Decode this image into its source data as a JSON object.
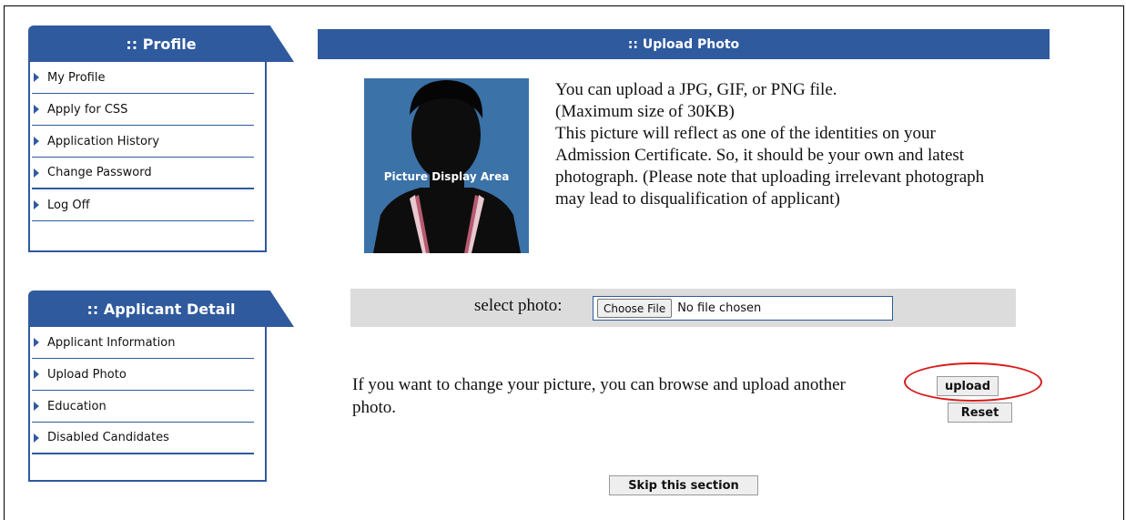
{
  "sidebar": {
    "profile": {
      "title": ":: Profile",
      "items": [
        {
          "label": "My Profile"
        },
        {
          "label": "Apply for CSS"
        },
        {
          "label": "Application History"
        },
        {
          "label": "Change Password"
        },
        {
          "label": "Log Off"
        }
      ]
    },
    "applicant": {
      "title": ":: Applicant Detail",
      "items": [
        {
          "label": "Applicant Information"
        },
        {
          "label": "Upload Photo"
        },
        {
          "label": "Education"
        },
        {
          "label": "Disabled Candidates"
        }
      ]
    }
  },
  "main": {
    "title": ":: Upload Photo",
    "photo_caption": "Picture Display Area",
    "instructions": [
      "You can upload a JPG, GIF, or PNG file.",
      "(Maximum size of 30KB)",
      "This picture will reflect as one of the identities on your Admission Certificate. So, it should be your own and latest photograph. (Please note that uploading irrelevant photograph may lead to disqualification of applicant)"
    ],
    "select_label": "select photo:",
    "choose_file_label": "Choose File",
    "file_status": "No file chosen",
    "change_text": "If you want to change your picture, you can browse and upload another photo.",
    "upload_label": "upload",
    "reset_label": "Reset",
    "skip_label": "Skip this section"
  },
  "colors": {
    "header_blue": "#2f5a9e",
    "highlight_red": "#d81b1b",
    "select_row_bg": "#dcdcdc"
  },
  "icons": {
    "sidebar_bullet": "triangle-right-icon",
    "photo_placeholder": "person-silhouette-icon"
  }
}
